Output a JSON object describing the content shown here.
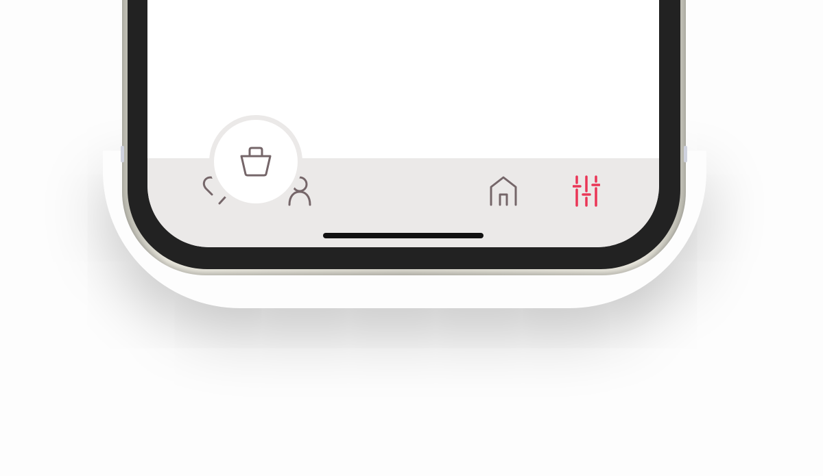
{
  "colors": {
    "icon_default": "#756669",
    "icon_active": "#ea3556",
    "tabbar_background": "#ebe9e8",
    "screen_background": "#ffffff",
    "fab_background": "#ffffff"
  },
  "tabbar": {
    "items": [
      {
        "icon": "heart-icon",
        "active": false
      },
      {
        "icon": "user-icon",
        "active": false
      },
      {
        "icon": "shopping-bag-icon",
        "active": false,
        "center_button": true
      },
      {
        "icon": "home-icon",
        "active": false
      },
      {
        "icon": "sliders-icon",
        "active": true
      }
    ]
  }
}
